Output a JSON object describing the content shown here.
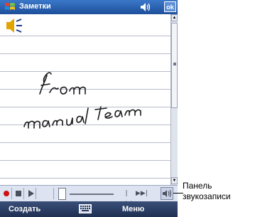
{
  "window": {
    "title": "Заметки",
    "ok_label": "ok"
  },
  "note": {
    "handwriting_lines": [
      "from",
      "manual team"
    ]
  },
  "softkeys": {
    "left": "Создать",
    "right": "Меню"
  },
  "callout": {
    "line1": "Панель",
    "line2": "звукозаписи"
  },
  "colors": {
    "titlebar": "#2a63b3",
    "softbar": "#2a3c63",
    "record": "#d01010",
    "ink": "#1a1a1a"
  }
}
